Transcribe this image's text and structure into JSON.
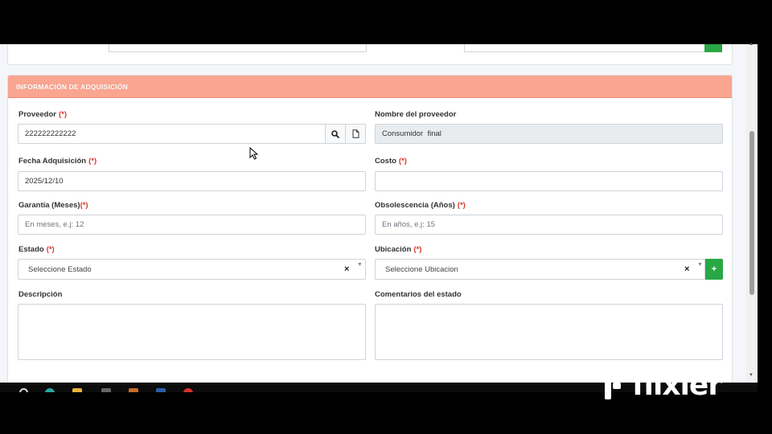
{
  "section": {
    "title": "INFORMACIÓN DE ADQUISICIÓN"
  },
  "required_mark": "(*)",
  "fields": {
    "proveedor": {
      "label": "Proveedor",
      "value": "222222222222"
    },
    "nombre_proveedor": {
      "label": "Nombre del proveedor",
      "value": "Consumidor  final"
    },
    "fecha_adquisicion": {
      "label": "Fecha Adquisición",
      "value": "2025/12/10"
    },
    "costo": {
      "label": "Costo",
      "value": ""
    },
    "garantia": {
      "label": "Garantía (Meses)",
      "placeholder": "En meses, e.j: 12"
    },
    "obsolescencia": {
      "label": "Obsolescencia (Años)",
      "placeholder": "En años, e.j: 15"
    },
    "estado": {
      "label": "Estado",
      "selected": "Seleccione Estado"
    },
    "ubicacion": {
      "label": "Ubicación",
      "selected": "Seleccione Ubicacion"
    },
    "descripcion": {
      "label": "Descripción",
      "value": ""
    },
    "comentarios": {
      "label": "Comentarios del estado",
      "value": ""
    }
  },
  "controls": {
    "clear_glyph": "×",
    "dropdown_glyph": "▼",
    "add_glyph": "+"
  },
  "scrollbar": {
    "up_glyph": "▲",
    "down_glyph": "▼"
  },
  "watermark": {
    "text": "flixier"
  },
  "colors": {
    "header_bg": "#f9a590",
    "required": "#d9362b",
    "add_button": "#28a745"
  }
}
